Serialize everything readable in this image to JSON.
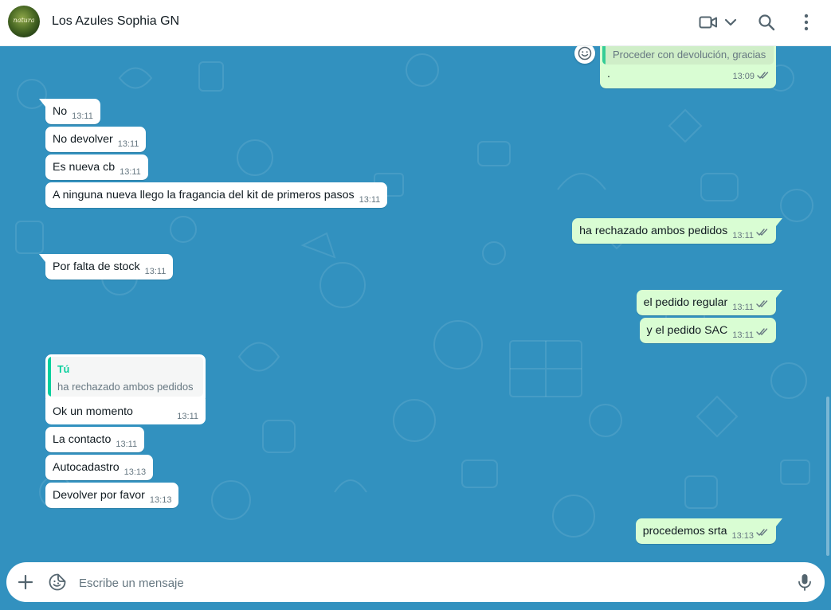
{
  "header": {
    "avatar_text": "natura",
    "contact_name": "Los Azules Sophia GN",
    "icons": [
      "video-call-icon",
      "chevron-down-icon",
      "search-icon",
      "kebab-menu-icon"
    ]
  },
  "colors": {
    "chat_background": "#3291bf",
    "incoming_bubble": "#ffffff",
    "outgoing_bubble": "#d9fdd3",
    "quote_accent": "#06cf9c",
    "read_ticks": "#667781"
  },
  "top_message": {
    "quoted_text": "Proceder con devolución, gracias",
    "text": ".",
    "time": "13:09",
    "status": "read",
    "reaction_icon": "emoji-react-icon"
  },
  "messages": [
    {
      "dir": "in",
      "text": "No",
      "time": "13:11"
    },
    {
      "dir": "in",
      "text": "No devolver",
      "time": "13:11"
    },
    {
      "dir": "in",
      "text": "Es nueva cb",
      "time": "13:11"
    },
    {
      "dir": "in",
      "text": "A ninguna nueva llego la fragancia del kit de primeros pasos",
      "time": "13:11"
    },
    {
      "dir": "out",
      "text": "ha rechazado ambos pedidos",
      "time": "13:11",
      "status": "delivered"
    },
    {
      "dir": "in",
      "text": "Por falta de stock",
      "time": "13:11"
    },
    {
      "dir": "out",
      "text": "el pedido regular",
      "time": "13:11",
      "status": "read"
    },
    {
      "dir": "out",
      "text": "y el pedido SAC",
      "time": "13:11",
      "status": "read"
    },
    {
      "dir": "in",
      "text": "Ok un momento",
      "time": "13:11",
      "quote": {
        "author": "Tú",
        "text": "ha rechazado ambos pedidos"
      }
    },
    {
      "dir": "in",
      "text": "La contacto",
      "time": "13:11"
    },
    {
      "dir": "in",
      "text": "Autocadastro",
      "time": "13:13"
    },
    {
      "dir": "in",
      "text": "Devolver por favor",
      "time": "13:13"
    },
    {
      "dir": "out",
      "text": "procedemos srta",
      "time": "13:13",
      "status": "read"
    }
  ],
  "composer": {
    "placeholder": "Escribe un mensaje",
    "value": "",
    "icons": [
      "plus-icon",
      "sticker-icon",
      "microphone-icon"
    ]
  }
}
